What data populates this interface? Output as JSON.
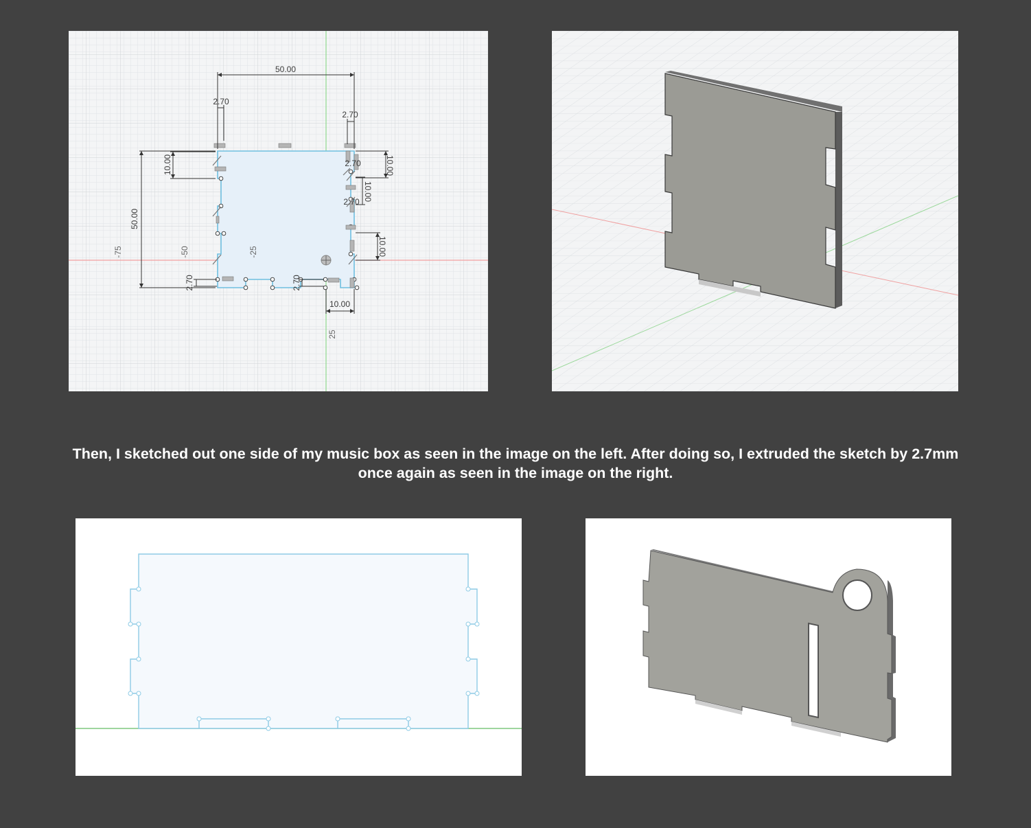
{
  "caption": {
    "line1": "Then, I sketched out one side of my music box as seen in the image on the left. After doing so, I extruded the sketch by 2.7mm",
    "line2": "once again as seen in the image on the right."
  },
  "sketch_view": {
    "dimensions": {
      "top_width": "50.00",
      "left_tab_width": "2.70",
      "right_tab_width": "2.70",
      "left_tab_height": "10.00",
      "overall_height": "50.00",
      "right_top": "10.00",
      "right_middle": "10.00",
      "right_lower": "10.00",
      "bottom_right_width": "10.00",
      "bottom_left_depth": "2.70",
      "bottom_mid_depth": "2.70",
      "right_inner_1": "2.70",
      "right_inner_2": "2.70"
    },
    "axis_labels": {
      "h_neg75": "-75",
      "h_neg50": "-50",
      "h_neg25": "-25",
      "v_25": "25"
    }
  },
  "colors": {
    "background": "#414141",
    "sketch_line": "#7ec3e0",
    "sketch_fill": "#e3eef8",
    "part_face": "#9e9e98",
    "x_axis": "#f08080",
    "y_axis": "#7ad17a"
  },
  "icons": {
    "origin": "origin-icon",
    "constraint": "constraint-glyph-icon"
  }
}
